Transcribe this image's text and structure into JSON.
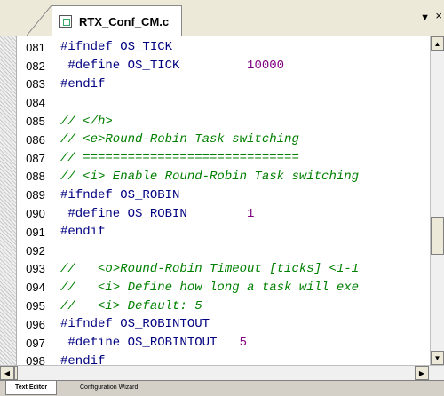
{
  "tab": {
    "title": "RTX_Conf_CM.c",
    "menu_glyph": "▼",
    "close_glyph": "×"
  },
  "colors": {
    "comment": "#008000",
    "preprocessor": "#000080",
    "number": "#800080",
    "background": "#ffffff"
  },
  "lines": [
    {
      "n": "081",
      "tokens": [
        {
          "t": "#ifndef OS_TICK",
          "c": "pp"
        }
      ]
    },
    {
      "n": "082",
      "tokens": [
        {
          "t": " #define OS_TICK",
          "c": "pp"
        },
        {
          "t": "         ",
          "c": "plain"
        },
        {
          "t": "10000",
          "c": "num"
        }
      ]
    },
    {
      "n": "083",
      "tokens": [
        {
          "t": "#endif",
          "c": "pp"
        }
      ]
    },
    {
      "n": "084",
      "tokens": []
    },
    {
      "n": "085",
      "tokens": [
        {
          "t": "// </h>",
          "c": "cmt"
        }
      ]
    },
    {
      "n": "086",
      "tokens": [
        {
          "t": "// <e>Round-Robin Task switching",
          "c": "cmt"
        }
      ]
    },
    {
      "n": "087",
      "tokens": [
        {
          "t": "// =============================",
          "c": "cmt"
        }
      ]
    },
    {
      "n": "088",
      "tokens": [
        {
          "t": "// <i> Enable Round-Robin Task switching",
          "c": "cmt"
        }
      ]
    },
    {
      "n": "089",
      "tokens": [
        {
          "t": "#ifndef OS_ROBIN",
          "c": "pp"
        }
      ]
    },
    {
      "n": "090",
      "tokens": [
        {
          "t": " #define OS_ROBIN",
          "c": "pp"
        },
        {
          "t": "        ",
          "c": "plain"
        },
        {
          "t": "1",
          "c": "num"
        }
      ]
    },
    {
      "n": "091",
      "tokens": [
        {
          "t": "#endif",
          "c": "pp"
        }
      ]
    },
    {
      "n": "092",
      "tokens": []
    },
    {
      "n": "093",
      "tokens": [
        {
          "t": "//   <o>Round-Robin Timeout [ticks] <1-1",
          "c": "cmt"
        }
      ]
    },
    {
      "n": "094",
      "tokens": [
        {
          "t": "//   <i> Define how long a task will exe",
          "c": "cmt"
        }
      ]
    },
    {
      "n": "095",
      "tokens": [
        {
          "t": "//   <i> Default: 5",
          "c": "cmt"
        }
      ]
    },
    {
      "n": "096",
      "tokens": [
        {
          "t": "#ifndef OS_ROBINTOUT",
          "c": "pp"
        }
      ]
    },
    {
      "n": "097",
      "tokens": [
        {
          "t": " #define OS_ROBINTOUT",
          "c": "pp"
        },
        {
          "t": "   ",
          "c": "plain"
        },
        {
          "t": "5",
          "c": "num"
        }
      ]
    },
    {
      "n": "098",
      "tokens": [
        {
          "t": "#endif",
          "c": "pp"
        }
      ]
    }
  ],
  "bottom_tabs": [
    {
      "label": "Text Editor",
      "active": true
    },
    {
      "label": "Configuration Wizard",
      "active": false
    }
  ]
}
